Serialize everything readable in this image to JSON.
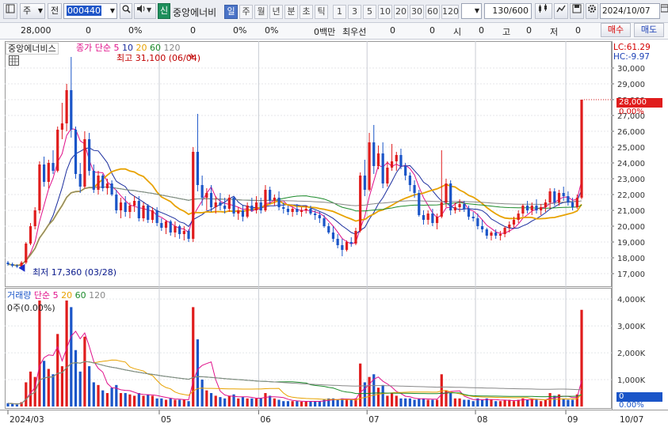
{
  "toolbar": {
    "market": "주",
    "type": "전",
    "code": "000440",
    "stock_name": "중앙에너비",
    "new_badge": "신",
    "periods": [
      "일",
      "주",
      "월",
      "년",
      "분",
      "초",
      "틱"
    ],
    "active_period": "일",
    "intervals": [
      "1",
      "3",
      "5",
      "10",
      "20",
      "30",
      "60",
      "120"
    ],
    "count": "130",
    "count_max": "/600",
    "date": "2024/10/07"
  },
  "infobar": {
    "price": "28,000",
    "change": "0",
    "change_pct": "0%",
    "volume": "0",
    "volume_pct": "0%",
    "ratio_pct": "0%",
    "amount": "0백만",
    "best_ask_label": "최우선",
    "best_ask": "0",
    "v2": "0",
    "open_label": "시",
    "open": "0",
    "high_label": "고",
    "high": "0",
    "low_label": "저",
    "low": "0",
    "buy": "매수",
    "sell": "매도"
  },
  "price_panel": {
    "stock_label": "중앙에너비스",
    "ma_label": "종가 단순",
    "ma_periods": [
      "5",
      "10",
      "20",
      "60",
      "120"
    ],
    "ma_colors": [
      "#e0108a",
      "#1a2d9e",
      "#e8a200",
      "#1b8a2a",
      "#888888"
    ],
    "high_annot": "최고 31,100 (06/04)",
    "low_annot": "최저 17,360 (03/28)",
    "lc": "LC:61.29",
    "hc": "HC:-9.97",
    "current_price_tag": "28,000",
    "current_pct_tag": "0.00%"
  },
  "volume_panel": {
    "label": "거래량",
    "ma_label": "단순",
    "ma_periods": [
      "5",
      "20",
      "60",
      "120"
    ],
    "ma_colors": [
      "#e0108a",
      "#e8a200",
      "#1b8a2a",
      "#888888"
    ],
    "value_text": "0주(0.00%)",
    "current_tag": "0",
    "current_pct_tag": "0.00%"
  },
  "chart_data": {
    "type": "candlestick",
    "price_axis": {
      "ticks": [
        "30,000",
        "29,000",
        "28,000",
        "27,000",
        "26,000",
        "25,000",
        "24,000",
        "23,000",
        "22,000",
        "21,000",
        "20,000",
        "19,000",
        "18,000",
        "17,000"
      ],
      "range": [
        16700,
        31300
      ]
    },
    "volume_axis": {
      "ticks": [
        "4,000K",
        "3,000K",
        "2,000K",
        "1,000K"
      ],
      "range": [
        0,
        4300
      ]
    },
    "x_labels": [
      "2024/03",
      "05",
      "06",
      "07",
      "08",
      "09",
      "10",
      "10/07"
    ],
    "candles": [
      [
        17700,
        17800,
        17500,
        17600,
        120
      ],
      [
        17600,
        17700,
        17400,
        17500,
        90
      ],
      [
        17500,
        17600,
        17360,
        17450,
        70
      ],
      [
        17450,
        17800,
        17400,
        17700,
        160
      ],
      [
        17700,
        19000,
        17600,
        18900,
        900
      ],
      [
        18900,
        20200,
        18800,
        20000,
        1300
      ],
      [
        20000,
        21200,
        19800,
        21000,
        1100
      ],
      [
        21000,
        24100,
        20800,
        23900,
        4100
      ],
      [
        23900,
        24400,
        22500,
        22800,
        1700
      ],
      [
        22800,
        24200,
        22400,
        24000,
        1400
      ],
      [
        24000,
        24800,
        23300,
        23500,
        1200
      ],
      [
        23500,
        26300,
        23400,
        26100,
        2700
      ],
      [
        26100,
        27800,
        25500,
        26500,
        1500
      ],
      [
        26500,
        29000,
        26000,
        28600,
        4000
      ],
      [
        28600,
        30700,
        25600,
        26100,
        3700
      ],
      [
        26100,
        26300,
        23000,
        23300,
        2100
      ],
      [
        23300,
        24000,
        22100,
        22500,
        1300
      ],
      [
        22500,
        26000,
        22400,
        25500,
        2600
      ],
      [
        25500,
        25900,
        23200,
        23500,
        1500
      ],
      [
        23500,
        23900,
        22100,
        22300,
        900
      ],
      [
        22300,
        23500,
        22000,
        23200,
        800
      ],
      [
        23200,
        23300,
        22200,
        22400,
        600
      ],
      [
        22400,
        23000,
        22000,
        22700,
        500
      ],
      [
        22700,
        22900,
        21900,
        22000,
        700
      ],
      [
        22000,
        22300,
        20800,
        21000,
        800
      ],
      [
        21000,
        21800,
        20500,
        21500,
        500
      ],
      [
        21500,
        21900,
        20600,
        20900,
        500
      ],
      [
        20900,
        21500,
        20500,
        21300,
        450
      ],
      [
        21300,
        21900,
        20900,
        21600,
        400
      ],
      [
        21600,
        21900,
        20300,
        20500,
        500
      ],
      [
        20500,
        21500,
        20300,
        21300,
        400
      ],
      [
        21300,
        21400,
        20200,
        20400,
        450
      ],
      [
        20400,
        21200,
        20200,
        21000,
        400
      ],
      [
        21000,
        21200,
        20000,
        20200,
        300
      ],
      [
        20200,
        20500,
        19700,
        19900,
        300
      ],
      [
        19900,
        20400,
        19500,
        20300,
        250
      ],
      [
        20300,
        20400,
        19400,
        19600,
        300
      ],
      [
        19600,
        20300,
        19300,
        20000,
        250
      ],
      [
        20000,
        20100,
        19200,
        19500,
        250
      ],
      [
        19500,
        20000,
        19100,
        19700,
        250
      ],
      [
        19700,
        19800,
        19000,
        19200,
        200
      ],
      [
        19200,
        25000,
        19000,
        24700,
        3700
      ],
      [
        24700,
        27100,
        22200,
        22600,
        2500
      ],
      [
        22600,
        23200,
        21300,
        21800,
        1000
      ],
      [
        21800,
        22400,
        21000,
        22100,
        600
      ],
      [
        22100,
        22600,
        20900,
        21200,
        500
      ],
      [
        21200,
        21900,
        20800,
        21500,
        400
      ],
      [
        21500,
        22100,
        21000,
        21300,
        350
      ],
      [
        21300,
        21800,
        20800,
        21100,
        300
      ],
      [
        21100,
        22000,
        20900,
        21800,
        400
      ],
      [
        21800,
        21900,
        20600,
        20800,
        450
      ],
      [
        20800,
        21200,
        20400,
        21000,
        300
      ],
      [
        21000,
        21300,
        20300,
        20600,
        350
      ],
      [
        20600,
        21500,
        20500,
        21300,
        300
      ],
      [
        21300,
        21800,
        20900,
        21000,
        300
      ],
      [
        21000,
        21900,
        20800,
        21500,
        300
      ],
      [
        21500,
        21800,
        20800,
        21000,
        300
      ],
      [
        21000,
        22600,
        20900,
        22300,
        500
      ],
      [
        22300,
        22500,
        21400,
        21600,
        400
      ],
      [
        21600,
        22000,
        21300,
        21800,
        300
      ],
      [
        21800,
        22200,
        21000,
        21200,
        250
      ],
      [
        21200,
        21500,
        20800,
        21100,
        200
      ],
      [
        21100,
        21300,
        20700,
        20900,
        200
      ],
      [
        20900,
        21200,
        20600,
        21100,
        200
      ],
      [
        21100,
        21400,
        20700,
        20900,
        200
      ],
      [
        20900,
        21200,
        20600,
        21000,
        180
      ],
      [
        21000,
        21300,
        20800,
        21100,
        180
      ],
      [
        21100,
        21300,
        20700,
        20800,
        200
      ],
      [
        20800,
        21000,
        20400,
        20700,
        200
      ],
      [
        20700,
        20900,
        20200,
        20500,
        200
      ],
      [
        20500,
        20700,
        19900,
        20000,
        250
      ],
      [
        20000,
        20200,
        19500,
        19600,
        300
      ],
      [
        19600,
        20000,
        19000,
        19200,
        300
      ],
      [
        19200,
        19500,
        18600,
        18800,
        250
      ],
      [
        18800,
        19200,
        18100,
        18500,
        300
      ],
      [
        18500,
        19100,
        18400,
        19000,
        250
      ],
      [
        19000,
        19300,
        18700,
        18900,
        250
      ],
      [
        18900,
        19900,
        18800,
        19700,
        300
      ],
      [
        19700,
        23400,
        19600,
        23200,
        1600
      ],
      [
        23200,
        24200,
        21900,
        22300,
        900
      ],
      [
        22300,
        25900,
        22200,
        25300,
        1100
      ],
      [
        25300,
        26400,
        23300,
        23800,
        1200
      ],
      [
        23800,
        25100,
        23600,
        24600,
        700
      ],
      [
        24600,
        25300,
        22400,
        22700,
        800
      ],
      [
        22700,
        24100,
        22500,
        23700,
        400
      ],
      [
        23700,
        25200,
        23500,
        24100,
        500
      ],
      [
        24100,
        24700,
        23500,
        24500,
        400
      ],
      [
        24500,
        24900,
        23600,
        23800,
        300
      ],
      [
        23800,
        24000,
        22900,
        23200,
        300
      ],
      [
        23200,
        23400,
        22200,
        22600,
        300
      ],
      [
        22600,
        22900,
        21800,
        22100,
        250
      ],
      [
        22100,
        22300,
        20600,
        20700,
        300
      ],
      [
        20700,
        21000,
        20100,
        20400,
        300
      ],
      [
        20400,
        21000,
        20100,
        20800,
        250
      ],
      [
        20800,
        21100,
        20000,
        20200,
        250
      ],
      [
        20200,
        20800,
        19800,
        20600,
        250
      ],
      [
        20600,
        24800,
        20500,
        21500,
        1200
      ],
      [
        21500,
        23000,
        21200,
        22700,
        600
      ],
      [
        22700,
        22900,
        20700,
        21000,
        500
      ],
      [
        21000,
        21500,
        20800,
        21200,
        300
      ],
      [
        21200,
        21700,
        20900,
        21400,
        300
      ],
      [
        21400,
        21600,
        20900,
        21100,
        250
      ],
      [
        21100,
        21300,
        20400,
        20600,
        250
      ],
      [
        20600,
        20900,
        20300,
        20500,
        200
      ],
      [
        20500,
        20800,
        19800,
        20000,
        300
      ],
      [
        20000,
        20400,
        19600,
        19800,
        250
      ],
      [
        19800,
        19900,
        19200,
        19400,
        300
      ],
      [
        19400,
        19700,
        19100,
        19600,
        250
      ],
      [
        19600,
        19800,
        19200,
        19400,
        200
      ],
      [
        19400,
        19700,
        19100,
        19500,
        200
      ],
      [
        19500,
        20000,
        19300,
        19900,
        250
      ],
      [
        19900,
        20300,
        19600,
        20100,
        250
      ],
      [
        20100,
        20600,
        19900,
        20400,
        200
      ],
      [
        20400,
        21000,
        20200,
        20800,
        250
      ],
      [
        20800,
        21400,
        20600,
        21300,
        300
      ],
      [
        21300,
        21600,
        20800,
        21000,
        250
      ],
      [
        21000,
        21500,
        20700,
        21300,
        300
      ],
      [
        21300,
        21700,
        20800,
        21000,
        250
      ],
      [
        21000,
        21400,
        20700,
        21200,
        200
      ],
      [
        21200,
        21700,
        20900,
        21500,
        250
      ],
      [
        21500,
        22400,
        21100,
        22200,
        500
      ],
      [
        22200,
        22400,
        21300,
        21500,
        400
      ],
      [
        21500,
        22300,
        21300,
        22100,
        450
      ],
      [
        22100,
        22500,
        21600,
        21900,
        300
      ],
      [
        21900,
        22200,
        21300,
        21500,
        250
      ],
      [
        21500,
        21800,
        21000,
        21200,
        250
      ],
      [
        21200,
        22000,
        21100,
        21800,
        450
      ],
      [
        21800,
        28000,
        21700,
        28000,
        3600
      ]
    ]
  }
}
